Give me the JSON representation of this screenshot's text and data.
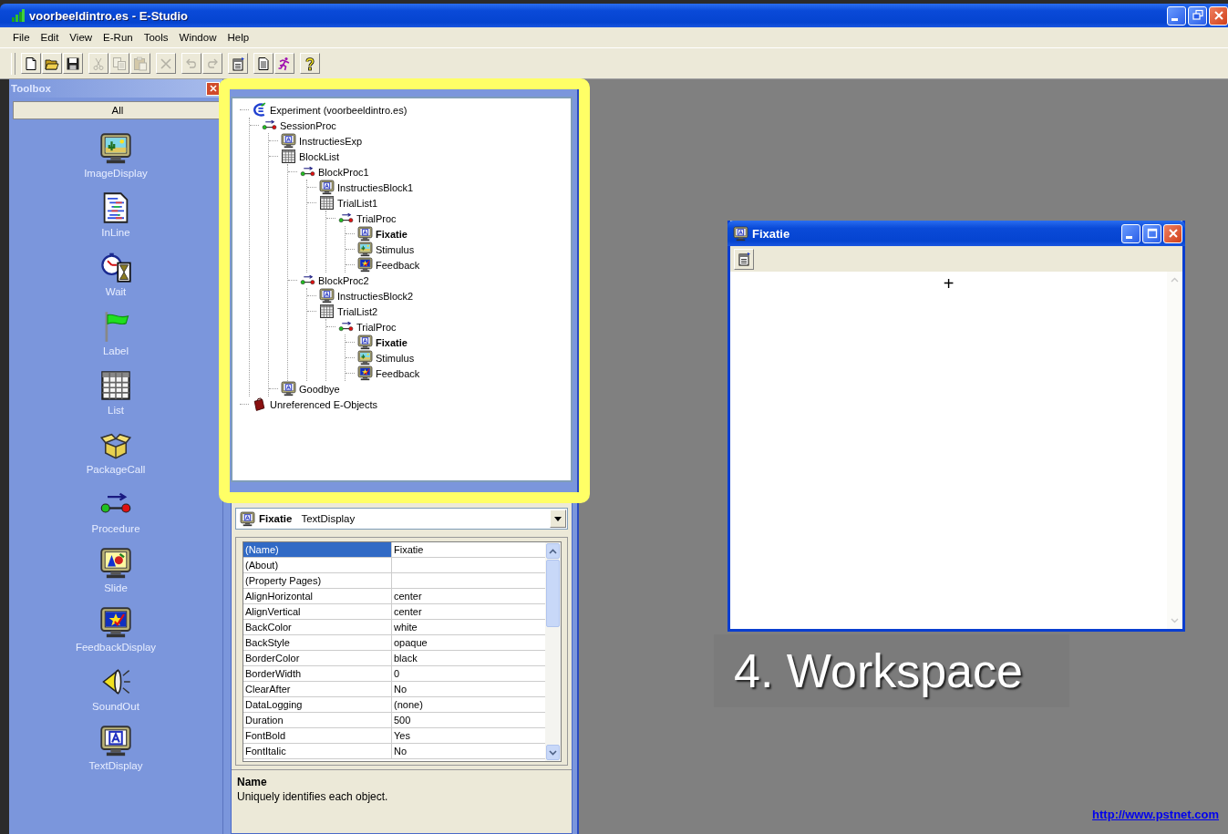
{
  "window": {
    "title": "voorbeeldintro.es - E-Studio"
  },
  "menu": [
    "File",
    "Edit",
    "View",
    "E-Run",
    "Tools",
    "Window",
    "Help"
  ],
  "toolbar_groups": [
    {
      "buttons": [
        {
          "kind": "new",
          "disabled": false
        },
        {
          "kind": "open",
          "disabled": false
        },
        {
          "kind": "save",
          "disabled": false
        }
      ]
    },
    {
      "buttons": [
        {
          "kind": "cut",
          "disabled": true
        },
        {
          "kind": "copy",
          "disabled": true
        },
        {
          "kind": "paste",
          "disabled": true
        }
      ]
    },
    {
      "buttons": [
        {
          "kind": "delete",
          "disabled": true
        }
      ]
    },
    {
      "buttons": [
        {
          "kind": "undo",
          "disabled": true
        },
        {
          "kind": "redo",
          "disabled": true
        }
      ]
    },
    {
      "buttons": [
        {
          "kind": "properties",
          "disabled": false
        }
      ]
    },
    {
      "buttons": [
        {
          "kind": "script",
          "disabled": false
        },
        {
          "kind": "run",
          "disabled": false
        }
      ]
    },
    {
      "buttons": [
        {
          "kind": "help",
          "disabled": false
        }
      ]
    }
  ],
  "toolbox": {
    "title": "Toolbox",
    "tab": "All",
    "items": [
      {
        "label": "ImageDisplay",
        "kind": "imagedisplay"
      },
      {
        "label": "InLine",
        "kind": "inline"
      },
      {
        "label": "Wait",
        "kind": "wait"
      },
      {
        "label": "Label",
        "kind": "label"
      },
      {
        "label": "List",
        "kind": "list"
      },
      {
        "label": "PackageCall",
        "kind": "packagecall"
      },
      {
        "label": "Procedure",
        "kind": "procedure"
      },
      {
        "label": "Slide",
        "kind": "slide"
      },
      {
        "label": "FeedbackDisplay",
        "kind": "feedback"
      },
      {
        "label": "SoundOut",
        "kind": "soundout"
      },
      {
        "label": "TextDisplay",
        "kind": "textdisplay"
      }
    ]
  },
  "structure": {
    "tree": [
      {
        "label": "Experiment (voorbeeldintro.es)",
        "kind": "experiment",
        "selected": false,
        "children": [
          {
            "label": "SessionProc",
            "kind": "procedure",
            "selected": false,
            "children": [
              {
                "label": "InstructiesExp",
                "kind": "textdisplay",
                "selected": false
              },
              {
                "label": "BlockList",
                "kind": "list",
                "selected": false,
                "children": [
                  {
                    "label": "BlockProc1",
                    "kind": "procedure",
                    "selected": false,
                    "children": [
                      {
                        "label": "InstructiesBlock1",
                        "kind": "textdisplay",
                        "selected": false
                      },
                      {
                        "label": "TrialList1",
                        "kind": "list",
                        "selected": false,
                        "children": [
                          {
                            "label": "TrialProc",
                            "kind": "procedure",
                            "selected": false,
                            "children": [
                              {
                                "label": "Fixatie",
                                "kind": "textdisplay",
                                "selected": true
                              },
                              {
                                "label": "Stimulus",
                                "kind": "imagedisplay",
                                "selected": false
                              },
                              {
                                "label": "Feedback",
                                "kind": "feedback",
                                "selected": false
                              }
                            ]
                          }
                        ]
                      }
                    ]
                  },
                  {
                    "label": "BlockProc2",
                    "kind": "procedure",
                    "selected": false,
                    "children": [
                      {
                        "label": "InstructiesBlock2",
                        "kind": "textdisplay",
                        "selected": false
                      },
                      {
                        "label": "TrialList2",
                        "kind": "list",
                        "selected": false,
                        "children": [
                          {
                            "label": "TrialProc",
                            "kind": "procedure",
                            "selected": false,
                            "children": [
                              {
                                "label": "Fixatie",
                                "kind": "textdisplay",
                                "selected": true
                              },
                              {
                                "label": "Stimulus",
                                "kind": "imagedisplay",
                                "selected": false
                              },
                              {
                                "label": "Feedback",
                                "kind": "feedback",
                                "selected": false
                              }
                            ]
                          }
                        ]
                      }
                    ]
                  }
                ]
              },
              {
                "label": "Goodbye",
                "kind": "textdisplay",
                "selected": false
              }
            ]
          }
        ]
      },
      {
        "label": "Unreferenced E-Objects",
        "kind": "unreferenced",
        "selected": false
      }
    ]
  },
  "properties": {
    "object": {
      "name": "Fixatie",
      "type": "TextDisplay",
      "kind": "textdisplay"
    },
    "rows": [
      {
        "name": "(Name)",
        "value": "Fixatie",
        "selected": true
      },
      {
        "name": "(About)",
        "selected": false
      },
      {
        "name": "(Property Pages)",
        "selected": false
      },
      {
        "name": "AlignHorizontal",
        "value": "center",
        "selected": false
      },
      {
        "name": "AlignVertical",
        "value": "center",
        "selected": false
      },
      {
        "name": "BackColor",
        "value": "white",
        "selected": false
      },
      {
        "name": "BackStyle",
        "value": "opaque",
        "selected": false
      },
      {
        "name": "BorderColor",
        "value": "black",
        "selected": false
      },
      {
        "name": "BorderWidth",
        "value": "0",
        "selected": false
      },
      {
        "name": "ClearAfter",
        "value": "No",
        "selected": false
      },
      {
        "name": "DataLogging",
        "value": "(none)",
        "selected": false
      },
      {
        "name": "Duration",
        "value": "500",
        "selected": false
      },
      {
        "name": "FontBold",
        "value": "Yes",
        "selected": false
      },
      {
        "name": "FontItalic",
        "value": "No",
        "selected": false
      }
    ],
    "description": {
      "title": "Name",
      "text": "Uniquely identifies each object."
    }
  },
  "workspace": {
    "window": {
      "title": "Fixatie",
      "content": "+"
    },
    "caption": "4. Workspace",
    "link": "http://www.pstnet.com"
  }
}
